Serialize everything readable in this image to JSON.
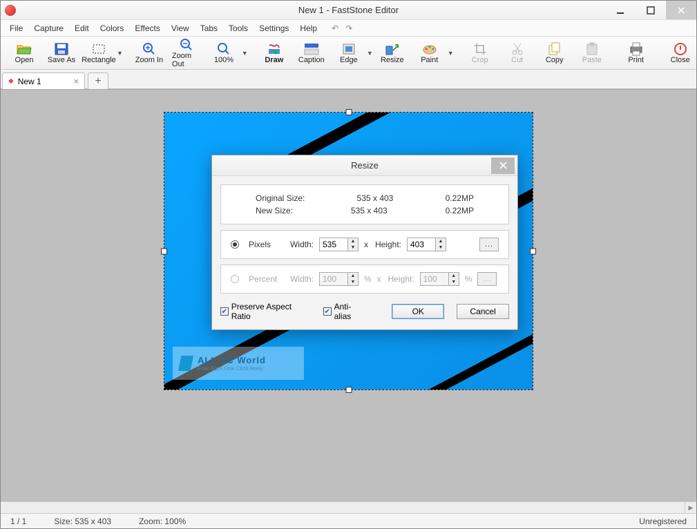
{
  "window": {
    "title": "New 1 - FastStone Editor"
  },
  "menu": {
    "items": [
      "File",
      "Capture",
      "Edit",
      "Colors",
      "Effects",
      "View",
      "Tabs",
      "Tools",
      "Settings",
      "Help"
    ]
  },
  "toolbar": {
    "open": "Open",
    "save_as": "Save As",
    "rectangle": "Rectangle",
    "zoom_in": "Zoom In",
    "zoom_out": "Zoom Out",
    "zoom_100": "100%",
    "draw": "Draw",
    "caption": "Caption",
    "edge": "Edge",
    "resize": "Resize",
    "paint": "Paint",
    "crop": "Crop",
    "cut": "Cut",
    "copy": "Copy",
    "paste": "Paste",
    "print": "Print",
    "close": "Close"
  },
  "tabs": {
    "items": [
      {
        "label": "New 1",
        "dirty": true
      }
    ]
  },
  "watermark": {
    "line1": "ALL PC World",
    "line2": "Free Apps One Click Away"
  },
  "status": {
    "page": "1 / 1",
    "size": "Size: 535 x 403",
    "zoom": "Zoom: 100%",
    "reg": "Unregistered"
  },
  "dialog": {
    "title": "Resize",
    "orig_label": "Original Size:",
    "orig_dim": "535 x 403",
    "orig_mp": "0.22MP",
    "new_label": "New Size:",
    "new_dim": "535 x 403",
    "new_mp": "0.22MP",
    "pixels_label": "Pixels",
    "percent_label": "Percent",
    "width_label": "Width:",
    "height_label": "Height:",
    "x_label": "x",
    "width_px": "535",
    "height_px": "403",
    "width_pc": "100",
    "height_pc": "100",
    "pct": "%",
    "browse": "...",
    "preserve": "Preserve Aspect Ratio",
    "antialias": "Anti-alias",
    "ok": "OK",
    "cancel": "Cancel"
  }
}
